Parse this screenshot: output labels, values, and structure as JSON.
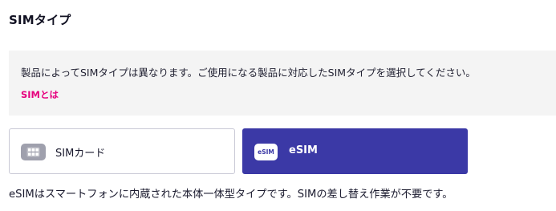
{
  "section": {
    "title": "SIMタイプ"
  },
  "info": {
    "text": "製品によってSIMタイプは異なります。ご使用になる製品に対応したSIMタイプを選択してください。",
    "link": "SIMとは"
  },
  "options": [
    {
      "label": "SIMカード",
      "icon": "sim-card-icon",
      "selected": false
    },
    {
      "label": "eSIM",
      "icon": "esim-icon",
      "icon_text": "eSIM",
      "selected": true
    }
  ],
  "description": "eSIMはスマートフォンに内蔵された本体一体型タイプです。SIMの差し替え作業が不要です。",
  "colors": {
    "accent": "#3b39a6",
    "link": "#e6007e",
    "info_bg": "#f4f4f4"
  }
}
